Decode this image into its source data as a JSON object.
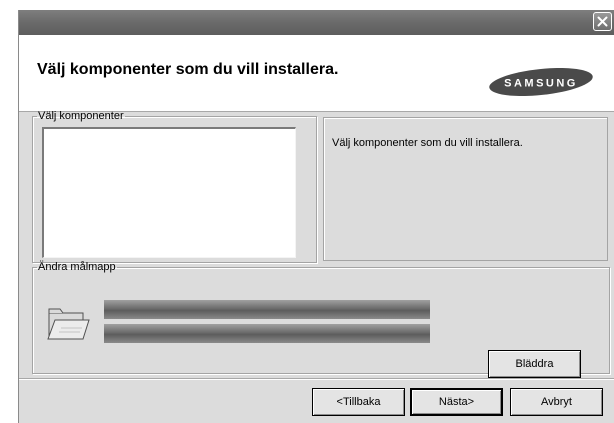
{
  "header": {
    "title": "Välj komponenter som du vill installera.",
    "logo_text": "SAMSUNG"
  },
  "components_group": {
    "label": "Välj komponenter",
    "items": []
  },
  "description": {
    "text": "Välj komponenter som du vill installera."
  },
  "destination_group": {
    "label": "Ändra målmapp",
    "browse_label": "Bläddra"
  },
  "footer": {
    "back_label": "<Tillbaka",
    "next_label": "Nästa>",
    "cancel_label": "Avbryt"
  },
  "icons": {
    "close": "close-icon",
    "folder": "folder-icon"
  }
}
